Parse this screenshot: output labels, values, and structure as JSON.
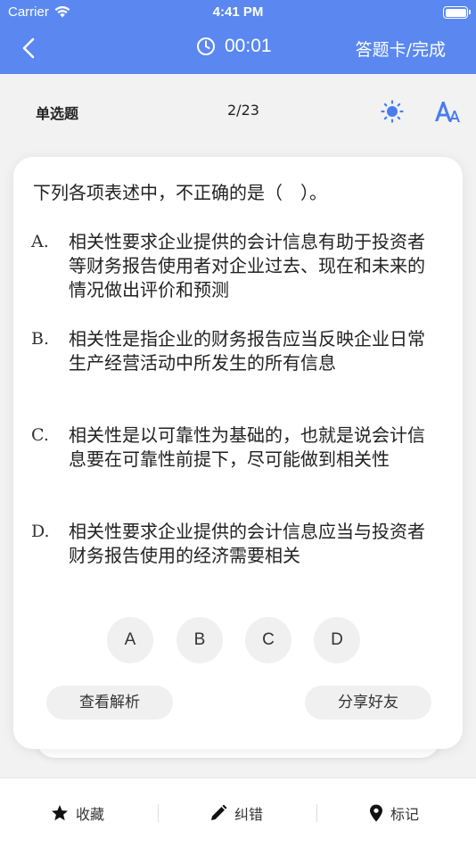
{
  "status_bar": {
    "carrier": "Carrier",
    "time": "4:41 PM"
  },
  "nav": {
    "timer": "00:01",
    "answer_card": "答题卡/完成"
  },
  "sub_header": {
    "question_type": "单选题",
    "progress": "2/23"
  },
  "question": {
    "stem": "下列各项表述中，不正确的是（　）。",
    "options": [
      {
        "letter": "A.",
        "text": "相关性要求企业提供的会计信息有助于投资者等财务报告使用者对企业过去、现在和未来的情况做出评价和预测"
      },
      {
        "letter": "B.",
        "text": "相关性是指企业的财务报告应当反映企业日常生产经营活动中所发生的所有信息"
      },
      {
        "letter": "C.",
        "text": "相关性是以可靠性为基础的，也就是说会计信息要在可靠性前提下，尽可能做到相关性"
      },
      {
        "letter": "D.",
        "text": "相关性要求企业提供的会计信息应当与投资者财务报告使用的经济需要相关"
      }
    ]
  },
  "choices": [
    "A",
    "B",
    "C",
    "D"
  ],
  "actions": {
    "view_analysis": "查看解析",
    "share": "分享好友"
  },
  "bottom_tabs": {
    "favorite": "收藏",
    "correct": "纠错",
    "mark": "标记"
  },
  "colors": {
    "accent": "#5a88f0",
    "sun": "#4a7cf0"
  },
  "icons": [
    "wifi-icon",
    "battery-icon",
    "back-chevron-icon",
    "clock-icon",
    "sun-icon",
    "font-size-icon",
    "star-icon",
    "pencil-icon",
    "location-pin-icon"
  ]
}
